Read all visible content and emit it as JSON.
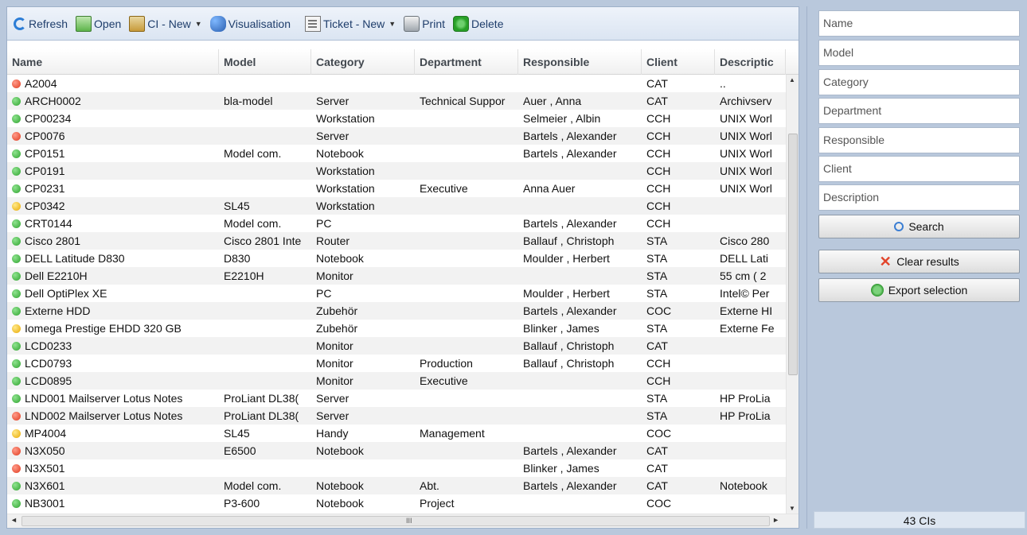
{
  "toolbar": {
    "refresh": "Refresh",
    "open": "Open",
    "ci_new": "CI - New",
    "visualisation": "Visualisation",
    "ticket_new": "Ticket - New",
    "print": "Print",
    "delete": "Delete"
  },
  "grid": {
    "columns": [
      "Name",
      "Model",
      "Category",
      "Department",
      "Responsible",
      "Client",
      "Descriptic"
    ],
    "rows": [
      {
        "status": "red",
        "name": "A2004",
        "model": "",
        "category": "",
        "department": "",
        "responsible": "",
        "client": "CAT",
        "description": ".."
      },
      {
        "status": "green",
        "name": "ARCH0002",
        "model": "bla-model",
        "category": "Server",
        "department": "Technical Suppor",
        "responsible": "Auer , Anna",
        "client": "CAT",
        "description": "Archivserv"
      },
      {
        "status": "green",
        "name": "CP00234",
        "model": "",
        "category": "Workstation",
        "department": "",
        "responsible": "Selmeier , Albin",
        "client": "CCH",
        "description": "UNIX Worl"
      },
      {
        "status": "red",
        "name": "CP0076",
        "model": "",
        "category": "Server",
        "department": "",
        "responsible": "Bartels , Alexander",
        "client": "CCH",
        "description": "UNIX Worl"
      },
      {
        "status": "green",
        "name": "CP0151",
        "model": "Model com.",
        "category": "Notebook",
        "department": "",
        "responsible": "Bartels , Alexander",
        "client": "CCH",
        "description": "UNIX Worl"
      },
      {
        "status": "green",
        "name": "CP0191",
        "model": "",
        "category": "Workstation",
        "department": "",
        "responsible": "",
        "client": "CCH",
        "description": "UNIX Worl"
      },
      {
        "status": "green",
        "name": "CP0231",
        "model": "",
        "category": "Workstation",
        "department": "Executive",
        "responsible": "Anna Auer",
        "client": "CCH",
        "description": "UNIX Worl"
      },
      {
        "status": "yellow",
        "name": "CP0342",
        "model": "SL45",
        "category": "Workstation",
        "department": "",
        "responsible": "",
        "client": "CCH",
        "description": ""
      },
      {
        "status": "green",
        "name": "CRT0144",
        "model": "Model com.",
        "category": "PC",
        "department": "",
        "responsible": "Bartels , Alexander",
        "client": "CCH",
        "description": ""
      },
      {
        "status": "green",
        "name": "Cisco 2801",
        "model": "Cisco 2801 Inte",
        "category": "Router",
        "department": "",
        "responsible": "Ballauf , Christoph",
        "client": "STA",
        "description": "Cisco 280"
      },
      {
        "status": "green",
        "name": "DELL Latitude D830",
        "model": "D830",
        "category": "Notebook",
        "department": "",
        "responsible": "Moulder , Herbert",
        "client": "STA",
        "description": "DELL Lati"
      },
      {
        "status": "green",
        "name": "Dell E2210H",
        "model": "E2210H",
        "category": "Monitor",
        "department": "",
        "responsible": "",
        "client": "STA",
        "description": "55 cm ( 2"
      },
      {
        "status": "green",
        "name": "Dell OptiPlex XE",
        "model": "",
        "category": "PC",
        "department": "",
        "responsible": "Moulder , Herbert",
        "client": "STA",
        "description": "Intel© Per"
      },
      {
        "status": "green",
        "name": "Externe HDD",
        "model": "",
        "category": "Zubehör",
        "department": "",
        "responsible": "Bartels , Alexander",
        "client": "COC",
        "description": "Externe HI"
      },
      {
        "status": "yellow",
        "name": "Iomega Prestige EHDD 320 GB",
        "model": "",
        "category": "Zubehör",
        "department": "",
        "responsible": "Blinker , James",
        "client": "STA",
        "description": "Externe Fe"
      },
      {
        "status": "green",
        "name": "LCD0233",
        "model": "",
        "category": "Monitor",
        "department": "",
        "responsible": "Ballauf , Christoph",
        "client": "CAT",
        "description": ""
      },
      {
        "status": "green",
        "name": "LCD0793",
        "model": "",
        "category": "Monitor",
        "department": "Production",
        "responsible": "Ballauf , Christoph",
        "client": "CCH",
        "description": ""
      },
      {
        "status": "green",
        "name": "LCD0895",
        "model": "",
        "category": "Monitor",
        "department": "Executive",
        "responsible": "",
        "client": "CCH",
        "description": ""
      },
      {
        "status": "green",
        "name": "LND001 Mailserver Lotus Notes",
        "model": "ProLiant DL38(",
        "category": "Server",
        "department": "",
        "responsible": "",
        "client": "STA",
        "description": "HP ProLia"
      },
      {
        "status": "red",
        "name": "LND002 Mailserver Lotus Notes",
        "model": "ProLiant DL38(",
        "category": "Server",
        "department": "",
        "responsible": "",
        "client": "STA",
        "description": "HP ProLia"
      },
      {
        "status": "yellow",
        "name": "MP4004",
        "model": "SL45",
        "category": "Handy",
        "department": "Management",
        "responsible": "",
        "client": "COC",
        "description": ""
      },
      {
        "status": "red",
        "name": "N3X050",
        "model": "E6500",
        "category": "Notebook",
        "department": "",
        "responsible": "Bartels , Alexander",
        "client": "CAT",
        "description": ""
      },
      {
        "status": "red",
        "name": "N3X501",
        "model": "",
        "category": "",
        "department": "",
        "responsible": "Blinker , James",
        "client": "CAT",
        "description": ""
      },
      {
        "status": "green",
        "name": "N3X601",
        "model": "Model com.",
        "category": "Notebook",
        "department": "Abt.",
        "responsible": "Bartels , Alexander",
        "client": "CAT",
        "description": "Notebook"
      },
      {
        "status": "green",
        "name": "NB3001",
        "model": "P3-600",
        "category": "Notebook",
        "department": "Project",
        "responsible": "",
        "client": "COC",
        "description": ""
      }
    ]
  },
  "filters": {
    "name": "Name",
    "model": "Model",
    "category": "Category",
    "department": "Department",
    "responsible": "Responsible",
    "client": "Client",
    "description": "Description"
  },
  "actions": {
    "search": "Search",
    "clear": "Clear results",
    "export": "Export selection"
  },
  "status": {
    "count": "43 CIs"
  },
  "scroll_glyphs": {
    "up": "▲",
    "down": "▼",
    "left": "◄",
    "right": "►",
    "grip": "III"
  }
}
